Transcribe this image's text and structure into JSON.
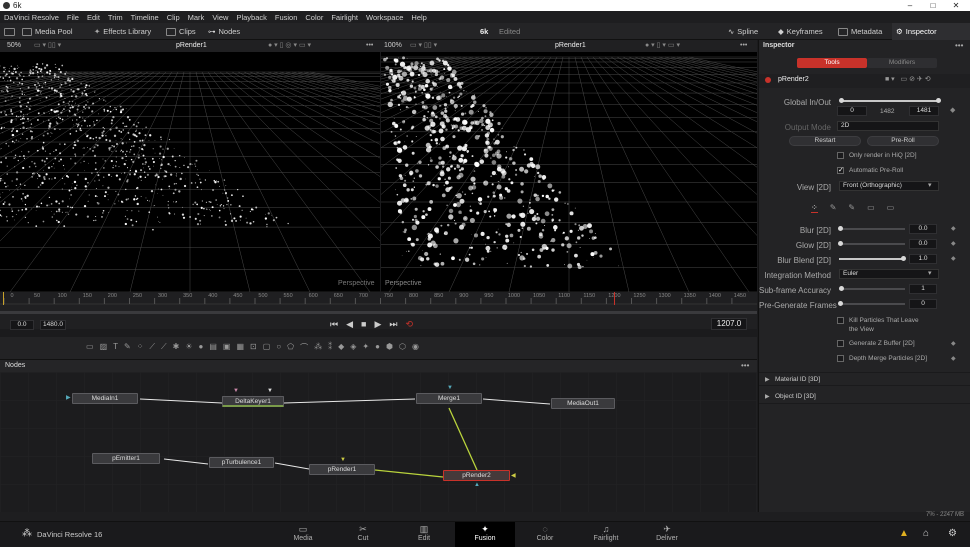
{
  "window": {
    "title": "6k"
  },
  "menu": [
    "DaVinci Resolve",
    "File",
    "Edit",
    "Trim",
    "Timeline",
    "Clip",
    "Mark",
    "View",
    "Playback",
    "Fusion",
    "Color",
    "Fairlight",
    "Workspace",
    "Help"
  ],
  "toolbar": {
    "media_pool": "Media Pool",
    "effects_library": "Effects Library",
    "clips": "Clips",
    "nodes": "Nodes",
    "project_name": "6k",
    "project_status": "Edited",
    "spline": "Spline",
    "keyframes": "Keyframes",
    "metadata": "Metadata",
    "inspector": "Inspector"
  },
  "viewer_left": {
    "zoom": "50%",
    "title": "pRender1",
    "overlay_label": "Perspective"
  },
  "viewer_right": {
    "zoom": "100%",
    "title": "pRender1",
    "overlay_label": "Perspective"
  },
  "ruler_ticks": [
    "0",
    "50",
    "100",
    "150",
    "200",
    "250",
    "300",
    "350",
    "400",
    "450",
    "500",
    "550",
    "600",
    "650",
    "700",
    "750",
    "800",
    "850",
    "900",
    "950",
    "1000",
    "1050",
    "1100",
    "1150",
    "1200",
    "1250",
    "1300",
    "1350",
    "1400",
    "1450"
  ],
  "transport": {
    "start": "0.0",
    "end": "1480.0",
    "current": "1207.0"
  },
  "nodes_panel": {
    "title": "Nodes",
    "nodes": [
      "MediaIn1",
      "DeltaKeyer1",
      "Merge1",
      "MediaOut1",
      "pEmitter1",
      "pTurbulence1",
      "pRender1",
      "pRender2"
    ]
  },
  "inspector": {
    "title": "Inspector",
    "tab_tools": "Tools",
    "tab_modifiers": "Modifiers",
    "node_name": "pRender2",
    "global_in_out_label": "Global In/Out",
    "global_in": "0",
    "global_mid": "1482",
    "global_out": "1481",
    "output_mode_label": "Output Mode",
    "output_mode_value": "2D",
    "restart": "Restart",
    "pre_roll": "Pre-Roll",
    "only_render_hiq": "Only render in HiQ [2D]",
    "automatic_pre_roll": "Automatic Pre-Roll",
    "view_label": "View [2D]",
    "view_value": "Front (Orthographic)",
    "blur_label": "Blur [2D]",
    "blur_value": "0.0",
    "glow_label": "Glow [2D]",
    "glow_value": "0.0",
    "blur_blend_label": "Blur Blend [2D]",
    "blur_blend_value": "1.0",
    "integration_method_label": "Integration Method",
    "integration_method_value": "Euler",
    "subframe_label": "Sub-frame Accuracy",
    "subframe_value": "1",
    "pregen_label": "Pre-Generate Frames",
    "pregen_value": "0",
    "kill_particles": "Kill Particles That Leave the View",
    "generate_z_buffer": "Generate Z Buffer [2D]",
    "depth_merge": "Depth Merge Particles [2D]",
    "material_id": "Material ID [3D]",
    "object_id": "Object ID [3D]",
    "memory": "7% - 2247 MB"
  },
  "bottom": {
    "app_name": "DaVinci Resolve 16",
    "pages": [
      "Media",
      "Cut",
      "Edit",
      "Fusion",
      "Color",
      "Fairlight",
      "Deliver"
    ],
    "active_page": "Fusion"
  },
  "colors": {
    "accent_red": "#c8322a",
    "active_tab": "#c8322a",
    "link_yellow": "#b9d33c",
    "link_white": "#e8e8e8"
  }
}
